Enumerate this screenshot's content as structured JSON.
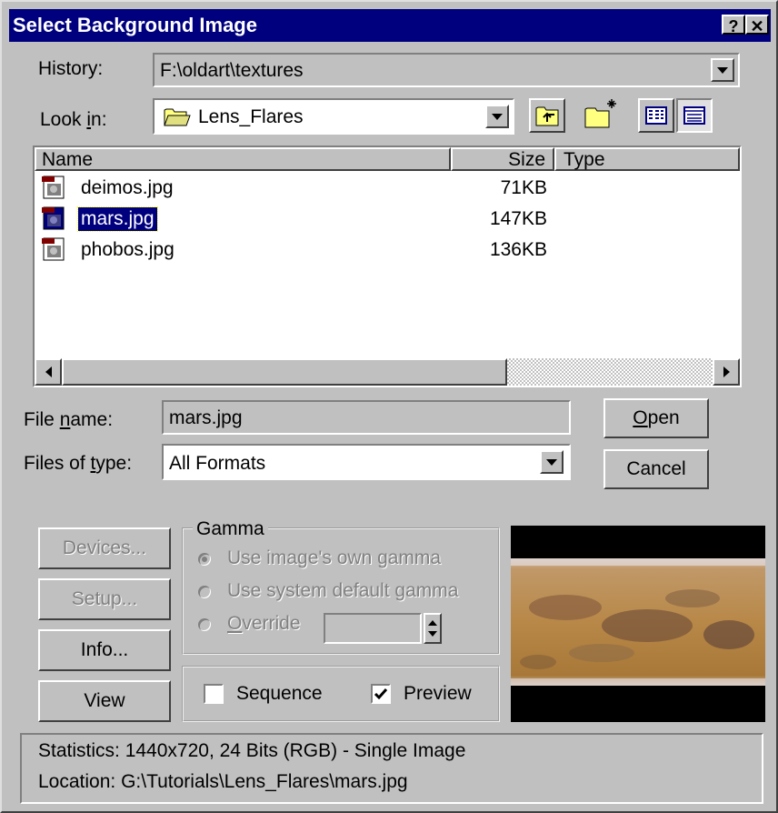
{
  "window": {
    "title": "Select Background Image",
    "help_glyph": "?",
    "close_glyph": "✕"
  },
  "history": {
    "label": "History:",
    "value": "F:\\oldart\\textures"
  },
  "look_in": {
    "label_pre": "Look ",
    "label_u": "i",
    "label_post": "n:",
    "value": "Lens_Flares"
  },
  "toolbar": [
    "up-one-level-icon",
    "create-new-folder-icon",
    "list-view-icon",
    "details-view-icon"
  ],
  "file_list": {
    "columns": {
      "name": "Name",
      "size": "Size",
      "type": "Type"
    },
    "files": [
      {
        "name": "deimos.jpg",
        "size": "71KB",
        "type": "",
        "selected": false
      },
      {
        "name": "mars.jpg",
        "size": "147KB",
        "type": "",
        "selected": true
      },
      {
        "name": "phobos.jpg",
        "size": "136KB",
        "type": "",
        "selected": false
      }
    ]
  },
  "file_name": {
    "label_pre": "File ",
    "label_u": "n",
    "label_post": "ame:",
    "value": "mars.jpg"
  },
  "file_type": {
    "label_pre": "Files of ",
    "label_u": "t",
    "label_post": "ype:",
    "value": "All Formats"
  },
  "buttons": {
    "open_u": "O",
    "open_rest": "pen",
    "cancel": "Cancel",
    "devices": "Devices...",
    "setup": "Setup...",
    "info": "Info...",
    "view": "View"
  },
  "gamma": {
    "legend": "Gamma",
    "own": "Use image's own gamma",
    "system": "Use system default gamma",
    "override_u": "O",
    "override_rest": "verride",
    "selected": "own",
    "override_value": ""
  },
  "options": {
    "sequence": {
      "label": "Sequence",
      "checked": false
    },
    "preview": {
      "label": "Preview",
      "checked": true
    }
  },
  "status": {
    "statistics": "Statistics:  1440x720, 24 Bits (RGB) - Single Image",
    "location": "Location:  G:\\Tutorials\\Lens_Flares\\mars.jpg"
  },
  "colors": {
    "title_bar": "#00007f",
    "selection": "#00007f",
    "dialog_face": "#c0c0c0"
  }
}
